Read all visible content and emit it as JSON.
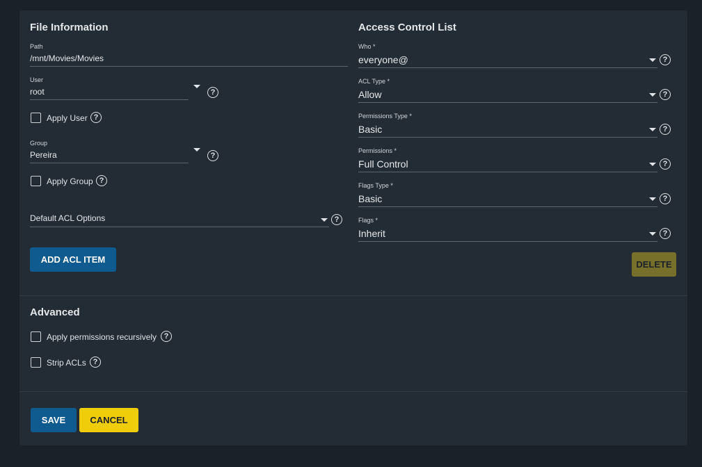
{
  "file_info": {
    "title": "File Information",
    "path": {
      "label": "Path",
      "value": "/mnt/Movies/Movies"
    },
    "user": {
      "label": "User",
      "value": "root"
    },
    "apply_user_label": "Apply User",
    "group": {
      "label": "Group",
      "value": "Pereira"
    },
    "apply_group_label": "Apply Group",
    "default_acl_options_label": "Default ACL Options",
    "add_acl_item_label": "ADD ACL ITEM"
  },
  "acl": {
    "title": "Access Control List",
    "who": {
      "label": "Who *",
      "value": "everyone@"
    },
    "acl_type": {
      "label": "ACL Type *",
      "value": "Allow"
    },
    "permissions_type": {
      "label": "Permissions Type *",
      "value": "Basic"
    },
    "permissions": {
      "label": "Permissions *",
      "value": "Full Control"
    },
    "flags_type": {
      "label": "Flags Type *",
      "value": "Basic"
    },
    "flags": {
      "label": "Flags *",
      "value": "Inherit"
    },
    "delete_label": "DELETE"
  },
  "advanced": {
    "title": "Advanced",
    "recursive_label": "Apply permissions recursively",
    "strip_label": "Strip ACLs"
  },
  "actions": {
    "save_label": "SAVE",
    "cancel_label": "CANCEL"
  },
  "icons": {
    "help": "help-circle-icon",
    "dropdown": "chevron-down-icon",
    "checkbox": "checkbox-unchecked"
  },
  "colors": {
    "primary": "#0f5a8f",
    "warning": "#f0cd0b",
    "disabled": "#77702b",
    "background": "#1b2129",
    "card": "#232c35"
  }
}
